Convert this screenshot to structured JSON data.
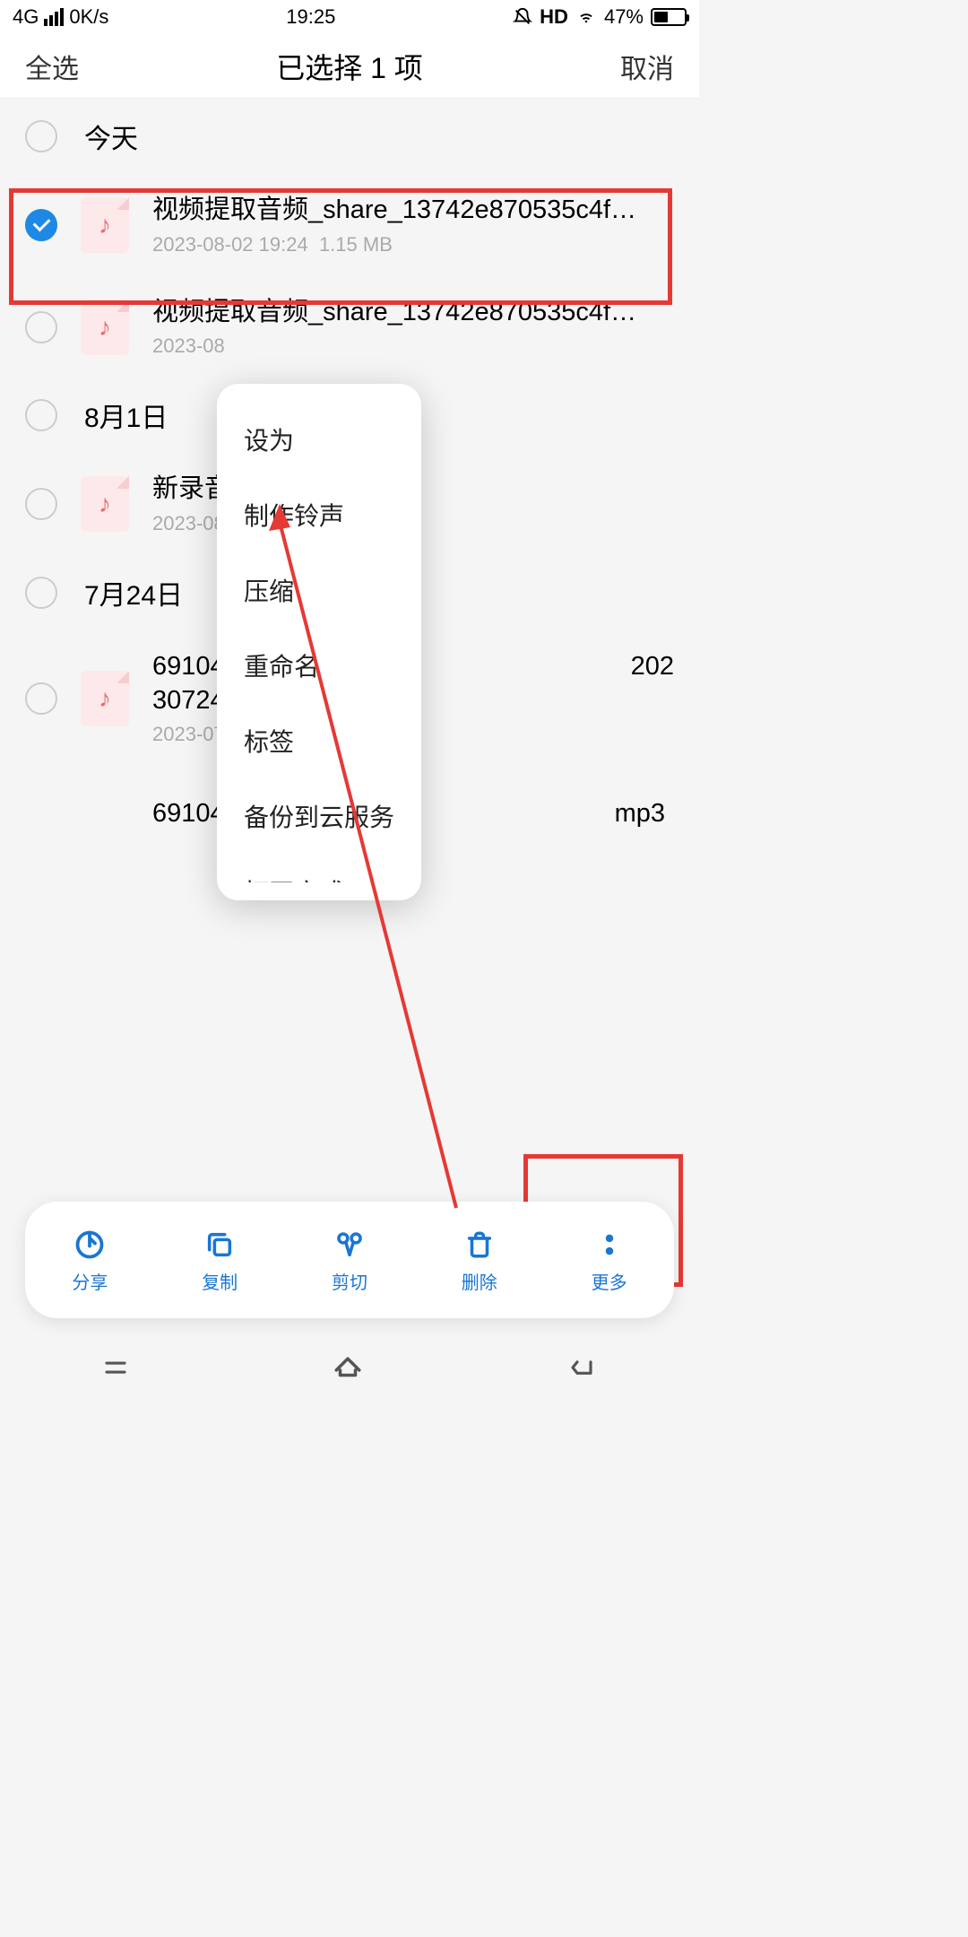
{
  "statusBar": {
    "network": "4G",
    "speed": "0K/s",
    "time": "19:25",
    "hd": "HD",
    "battery": "47%"
  },
  "header": {
    "selectAll": "全选",
    "title": "已选择 1 项",
    "cancel": "取消"
  },
  "sections": {
    "today": "今天",
    "aug1": "8月1日",
    "jul24": "7月24日"
  },
  "files": {
    "file1": {
      "name": "视频提取音频_share_13742e870535c4f…",
      "date": "2023-08-02 19:24",
      "size": "1.15 MB"
    },
    "file2": {
      "name": "视频提取音频_share_13742e870535c4f…",
      "date": "2023-08"
    },
    "file3": {
      "name": "新录音",
      "date": "2023-08"
    },
    "file4": {
      "name1": "69104",
      "name2": "30724",
      "date": "2023-07",
      "tail": "202"
    },
    "file5": {
      "name": "69104",
      "tail": "mp3"
    }
  },
  "menu": {
    "setAs": "设为",
    "makeRingtone": "制作铃声",
    "compress": "压缩",
    "rename": "重命名",
    "tag": "标签",
    "backupCloud": "备份到云服务",
    "openWith": "打开方式"
  },
  "bottomBar": {
    "share": "分享",
    "copy": "复制",
    "cut": "剪切",
    "delete": "删除",
    "more": "更多"
  }
}
